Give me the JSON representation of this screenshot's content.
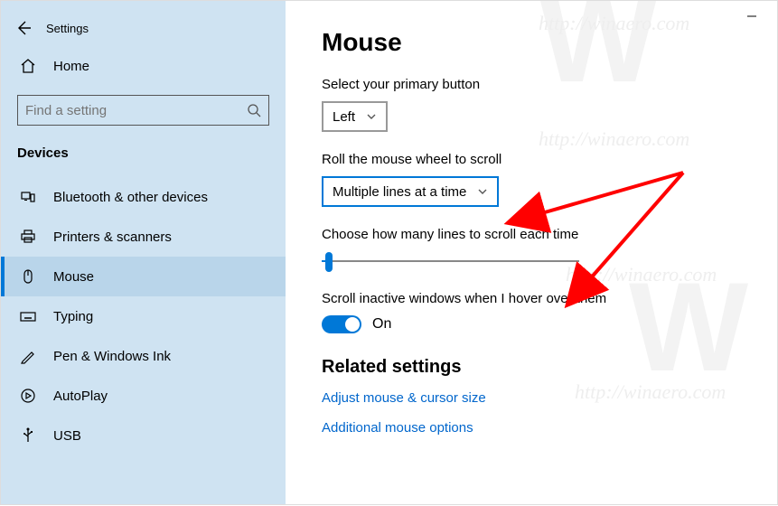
{
  "window": {
    "title": "Settings"
  },
  "sidebar": {
    "home": "Home",
    "search_placeholder": "Find a setting",
    "section": "Devices",
    "items": [
      {
        "label": "Bluetooth & other devices"
      },
      {
        "label": "Printers & scanners"
      },
      {
        "label": "Mouse"
      },
      {
        "label": "Typing"
      },
      {
        "label": "Pen & Windows Ink"
      },
      {
        "label": "AutoPlay"
      },
      {
        "label": "USB"
      }
    ]
  },
  "page": {
    "title": "Mouse",
    "primary_label": "Select your primary button",
    "primary_value": "Left",
    "roll_label": "Roll the mouse wheel to scroll",
    "roll_value": "Multiple lines at a time",
    "lines_label": "Choose how many lines to scroll each time",
    "inactive_label": "Scroll inactive windows when I hover over them",
    "inactive_value": "On",
    "related_heading": "Related settings",
    "link1": "Adjust mouse & cursor size",
    "link2": "Additional mouse options"
  }
}
